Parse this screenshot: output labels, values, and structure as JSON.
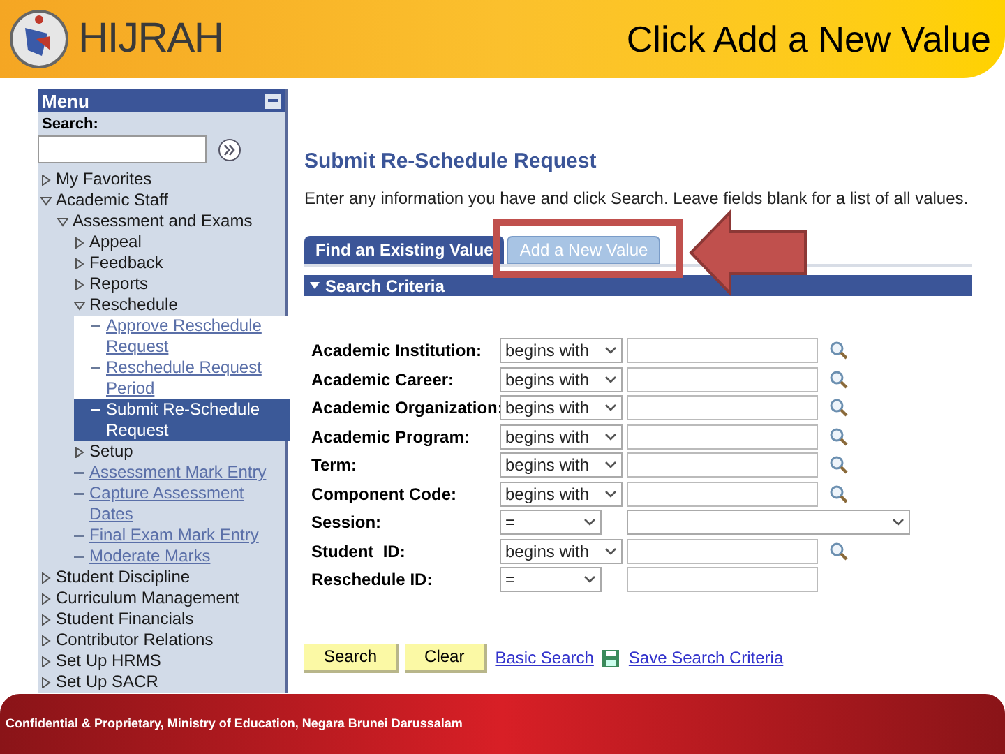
{
  "header": {
    "logo_text": "HIJRAH",
    "title": "Click Add a New Value"
  },
  "menu": {
    "title": "Menu",
    "search_label": "Search:",
    "items": [
      {
        "label": "My Favorites",
        "kind": "folder",
        "expanded": false
      },
      {
        "label": "Academic Staff",
        "kind": "folder",
        "expanded": true,
        "children": [
          {
            "label": "Assessment and Exams",
            "kind": "folder",
            "expanded": true,
            "children": [
              {
                "label": "Appeal",
                "kind": "folder",
                "expanded": false
              },
              {
                "label": "Feedback",
                "kind": "folder",
                "expanded": false
              },
              {
                "label": "Reports",
                "kind": "folder",
                "expanded": false
              },
              {
                "label": "Reschedule",
                "kind": "folder",
                "expanded": true,
                "children": [
                  {
                    "label": "Approve Reschedule Request",
                    "kind": "link",
                    "selected": false
                  },
                  {
                    "label": "Reschedule Request Period",
                    "kind": "link",
                    "selected": false
                  },
                  {
                    "label": "Submit Re-Schedule Request",
                    "kind": "link",
                    "selected": true
                  }
                ]
              },
              {
                "label": "Setup",
                "kind": "folder",
                "expanded": false
              },
              {
                "label": "Assessment Mark Entry",
                "kind": "link",
                "selected": false
              },
              {
                "label": "Capture Assessment Dates",
                "kind": "link",
                "selected": false
              },
              {
                "label": "Final Exam Mark Entry",
                "kind": "link",
                "selected": false
              },
              {
                "label": "Moderate Marks",
                "kind": "link",
                "selected": false
              }
            ]
          }
        ]
      },
      {
        "label": "Student Discipline",
        "kind": "folder",
        "expanded": false
      },
      {
        "label": "Curriculum Management",
        "kind": "folder",
        "expanded": false
      },
      {
        "label": "Student Financials",
        "kind": "folder",
        "expanded": false
      },
      {
        "label": "Contributor Relations",
        "kind": "folder",
        "expanded": false
      },
      {
        "label": "Set Up HRMS",
        "kind": "folder",
        "expanded": false
      },
      {
        "label": "Set Up SACR",
        "kind": "folder",
        "expanded": false
      }
    ]
  },
  "page": {
    "title": "Submit Re-Schedule Request",
    "instructions": "Enter any information you have and click Search. Leave fields blank for a list of all values.",
    "tabs": [
      {
        "label": "Find an Existing Value",
        "selected": true,
        "highlighted": false
      },
      {
        "label": "Add a New Value",
        "selected": false,
        "highlighted": true
      }
    ],
    "section_title": "Search Criteria",
    "fields": [
      {
        "label": "Academic Institution:",
        "operator": "begins with",
        "kind": "lookup"
      },
      {
        "label": "Academic Career:",
        "operator": "begins with",
        "kind": "lookup"
      },
      {
        "label": "Academic Organization:",
        "operator": "begins with",
        "kind": "lookup"
      },
      {
        "label": "Academic Program:",
        "operator": "begins with",
        "kind": "lookup"
      },
      {
        "label": "Term:",
        "operator": "begins with",
        "kind": "lookup"
      },
      {
        "label": "Component Code:",
        "operator": "begins with",
        "kind": "lookup"
      },
      {
        "label": "Session:",
        "operator": "=",
        "kind": "dropdown"
      },
      {
        "label": "Student  ID:",
        "operator": "begins with",
        "kind": "lookup"
      },
      {
        "label": "Reschedule ID:",
        "operator": "=",
        "kind": "plain"
      }
    ],
    "buttons": [
      "Search",
      "Clear"
    ],
    "links": [
      {
        "label": "Basic Search",
        "kind": "plain"
      },
      {
        "label": "Save Search Criteria",
        "kind": "save"
      }
    ]
  },
  "footer": {
    "text": "Confidential & Proprietary, Ministry of Education, Negara Brunei Darussalam"
  }
}
